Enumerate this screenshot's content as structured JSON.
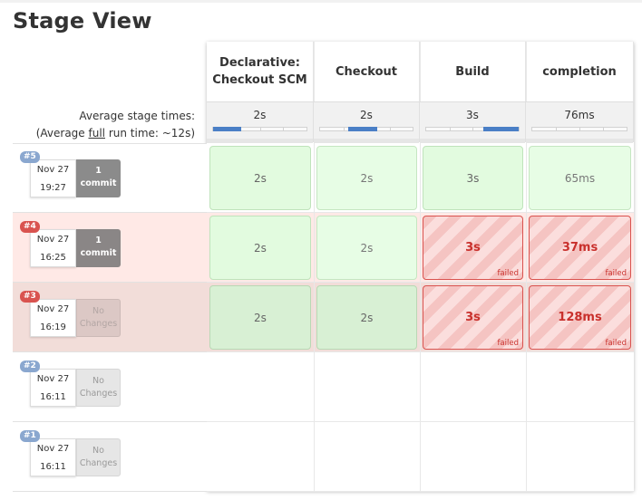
{
  "title": "Stage View",
  "average": {
    "line1": "Average stage times:",
    "line2_pre": "(Average ",
    "line2_link": "full",
    "line2_post": " run time: ~12s)"
  },
  "stages": [
    {
      "name": "Declarative: Checkout SCM",
      "avg": "2s",
      "bar_start": 0.0,
      "bar_end": 0.3
    },
    {
      "name": "Checkout",
      "avg": "2s",
      "bar_start": 0.3,
      "bar_end": 0.62
    },
    {
      "name": "Build",
      "avg": "3s",
      "bar_start": 0.62,
      "bar_end": 1.0
    },
    {
      "name": "completion",
      "avg": "76ms",
      "bar_start": null,
      "bar_end": null
    }
  ],
  "builds": [
    {
      "number": "#5",
      "badge_color": "#8aa7cf",
      "date": "Nov 27",
      "time": "19:27",
      "changes_line1": "1",
      "changes_line2": "commit",
      "changes_type": "commit",
      "row_bg": "#ffffff",
      "cells": [
        {
          "text": "2s",
          "status": "ok"
        },
        {
          "text": "2s",
          "status": "okl"
        },
        {
          "text": "3s",
          "status": "ok"
        },
        {
          "text": "65ms",
          "status": "okl"
        }
      ]
    },
    {
      "number": "#4",
      "badge_color": "#d9534f",
      "date": "Nov 27",
      "time": "16:25",
      "changes_line1": "1",
      "changes_line2": "commit",
      "changes_type": "commit",
      "row_bg": "#ffe9e6",
      "cells": [
        {
          "text": "2s",
          "status": "ok"
        },
        {
          "text": "2s",
          "status": "okl"
        },
        {
          "text": "3s",
          "status": "fail",
          "tag": "failed"
        },
        {
          "text": "37ms",
          "status": "fail",
          "tag": "failed"
        }
      ]
    },
    {
      "number": "#3",
      "badge_color": "#d9534f",
      "date": "Nov 27",
      "time": "16:19",
      "changes_line1": "No",
      "changes_line2": "Changes",
      "changes_type": "none-tint",
      "row_bg": "#f2ddd9",
      "cells": [
        {
          "text": "2s",
          "status": "ok-dim"
        },
        {
          "text": "2s",
          "status": "ok-dim"
        },
        {
          "text": "3s",
          "status": "fail",
          "tag": "failed"
        },
        {
          "text": "128ms",
          "status": "fail",
          "tag": "failed"
        }
      ]
    },
    {
      "number": "#2",
      "badge_color": "#8aa7cf",
      "date": "Nov 27",
      "time": "16:11",
      "changes_line1": "No",
      "changes_line2": "Changes",
      "changes_type": "none",
      "row_bg": "#ffffff",
      "cells": []
    },
    {
      "number": "#1",
      "badge_color": "#8aa7cf",
      "date": "Nov 27",
      "time": "16:11",
      "changes_line1": "No",
      "changes_line2": "Changes",
      "changes_type": "none",
      "row_bg": "#ffffff",
      "cells": []
    }
  ]
}
